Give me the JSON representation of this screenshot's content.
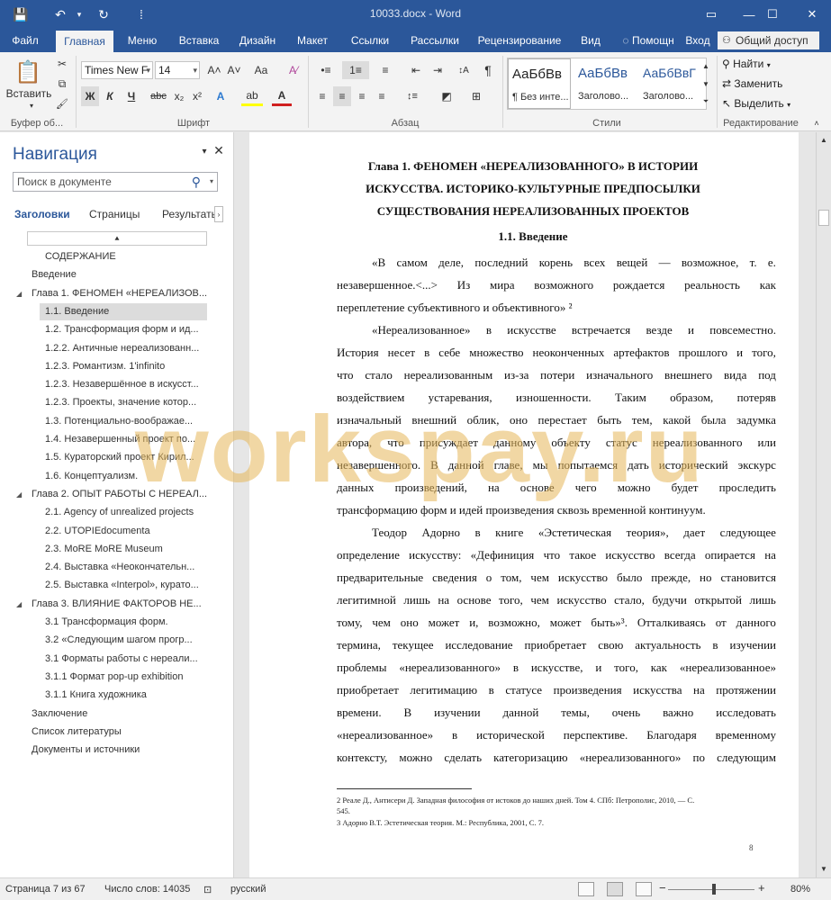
{
  "titlebar": {
    "title": "10033.docx - Word",
    "save_icon": "💾",
    "undo_icon": "↶",
    "redo_icon": "↻",
    "customize_icon": "⁞"
  },
  "window": {
    "restore": "▭",
    "minimize": "—",
    "maximize": "☐",
    "close": "✕"
  },
  "menu": {
    "tabs": [
      "Файл",
      "Главная",
      "Меню",
      "Вставка",
      "Дизайн",
      "Макет",
      "Ссылки",
      "Рассылки",
      "Рецензирование",
      "Вид"
    ],
    "help": "Помощн",
    "login": "Вход",
    "share": "Общий доступ"
  },
  "ribbon": {
    "clipboard": {
      "paste": "Вставить",
      "label": "Буфер об...",
      "cut": "✂",
      "copy": "⧉",
      "brush": "🖌"
    },
    "font": {
      "family": "Times New F",
      "size": "14",
      "label": "Шрифт",
      "grow": "A˄",
      "shrink": "A˅",
      "case": "Aa",
      "clear": "A⁄",
      "bold": "Ж",
      "italic": "К",
      "underline": "Ч",
      "strike": "abc",
      "sub": "x₂",
      "sup": "x²",
      "effects": "A",
      "highlight": "ab",
      "color": "A"
    },
    "paragraph": {
      "label": "Абзац",
      "pilcrow": "¶",
      "sort": "↕A",
      "bullets": "•≡",
      "numbering": "1≡",
      "multilevel": "≡",
      "dec_indent": "⇤",
      "inc_indent": "⇥",
      "align_left": "≡",
      "center": "≡",
      "align_right": "≡",
      "justify": "≡",
      "spacing": "↕≡",
      "shading": "◩",
      "borders": "⊞"
    },
    "styles": {
      "label": "Стили",
      "items": [
        {
          "preview": "АаБбВв",
          "name": "¶ Без инте..."
        },
        {
          "preview": "АаБбВв",
          "name": "Заголово..."
        },
        {
          "preview": "АаБбВвГ",
          "name": "Заголово..."
        }
      ]
    },
    "editing": {
      "label": "Редактирование",
      "find": "Найти",
      "replace": "Заменить",
      "select": "Выделить"
    }
  },
  "nav": {
    "title": "Навигация",
    "search_placeholder": "Поиск в документе",
    "search_icon": "⚲",
    "tabs": [
      "Заголовки",
      "Страницы",
      "Результаты"
    ],
    "collapse_icon": "⯅",
    "headings": [
      {
        "text": "СОДЕРЖАНИЕ",
        "level": 2,
        "tri": ""
      },
      {
        "text": "Введение",
        "level": 1,
        "tri": ""
      },
      {
        "text": "Глава 1. ФЕНОМЕН «НЕРЕАЛИЗОВ...",
        "level": 1,
        "tri": "◢"
      },
      {
        "text": "1.1. Введение",
        "level": 2,
        "tri": "",
        "sel": true
      },
      {
        "text": "1.2. Трансформация форм и ид...",
        "level": 2,
        "tri": ""
      },
      {
        "text": "1.2.2. Античные нереализованн...",
        "level": 2,
        "tri": ""
      },
      {
        "text": "1.2.3. Романтизм. 1'infinito",
        "level": 2,
        "tri": ""
      },
      {
        "text": "1.2.3. Незавершённое в искусст...",
        "level": 2,
        "tri": ""
      },
      {
        "text": "1.2.3. Проекты, значение котор...",
        "level": 2,
        "tri": ""
      },
      {
        "text": "1.3. Потенциально-воображае...",
        "level": 2,
        "tri": ""
      },
      {
        "text": "1.4. Незавершенный проект по...",
        "level": 2,
        "tri": ""
      },
      {
        "text": "1.5. Кураторский проект Кирил...",
        "level": 2,
        "tri": ""
      },
      {
        "text": "1.6. Концептуализм.",
        "level": 2,
        "tri": ""
      },
      {
        "text": "Глава 2. ОПЫТ РАБОТЫ С НЕРЕАЛ...",
        "level": 1,
        "tri": "◢"
      },
      {
        "text": "2.1. Agency of unrealized projects",
        "level": 2,
        "tri": ""
      },
      {
        "text": "2.2. UTOPIEdocumenta",
        "level": 2,
        "tri": ""
      },
      {
        "text": "2.3. MoRE MoRE Museum",
        "level": 2,
        "tri": ""
      },
      {
        "text": "2.4. Выставка «Неокончательн...",
        "level": 2,
        "tri": ""
      },
      {
        "text": "2.5. Выставка «Interpol», курато...",
        "level": 2,
        "tri": ""
      },
      {
        "text": "Глава 3. ВЛИЯНИЕ ФАКТОРОВ НЕ...",
        "level": 1,
        "tri": "◢"
      },
      {
        "text": "3.1 Трансформация форм.",
        "level": 2,
        "tri": ""
      },
      {
        "text": "3.2 «Следующим шагом прогр...",
        "level": 2,
        "tri": ""
      },
      {
        "text": "3.1 Форматы работы с нереали...",
        "level": 2,
        "tri": ""
      },
      {
        "text": "3.1.1 Формат pop-up exhibition",
        "level": 2,
        "tri": ""
      },
      {
        "text": "3.1.1 Книга художника",
        "level": 2,
        "tri": ""
      },
      {
        "text": "Заключение",
        "level": 1,
        "tri": ""
      },
      {
        "text": "Список литературы",
        "level": 1,
        "tri": ""
      },
      {
        "text": "Документы и источники",
        "level": 1,
        "tri": ""
      }
    ]
  },
  "doc": {
    "chapter_lines": [
      "Глава 1. ФЕНОМЕН «НЕРЕАЛИЗОВАННОГО» В ИСТОРИИ",
      "ИСКУССТВА. ИСТОРИКО-КУЛЬТУРНЫЕ ПРЕДПОСЫЛКИ",
      "СУЩЕСТВОВАНИЯ НЕРЕАЛИЗОВАННЫХ ПРОЕКТОВ"
    ],
    "section_title": "1.1. Введение",
    "lines": [
      {
        "text": "«В самом деле, последний корень всех вещей — возможное, т. е.",
        "indent": true,
        "just": true
      },
      {
        "text": "незавершенное.<...> Из мира возможного рождается реальность как",
        "indent": false,
        "just": true
      },
      {
        "text": "переплетение субъективного и объективного» ²",
        "indent": false,
        "just": false
      },
      {
        "text": "«Нереализованное» в искусстве встречается везде и повсеместно.",
        "indent": true,
        "just": true
      },
      {
        "text": "История несет в себе множество неоконченных артефактов прошлого и того,",
        "indent": false,
        "just": true
      },
      {
        "text": "что стало нереализованным из-за потери изначального внешнего вида под",
        "indent": false,
        "just": true
      },
      {
        "text": "воздействием устаревания, изношенности. Таким образом, потеряв",
        "indent": false,
        "just": true
      },
      {
        "text": "изначальный внешний облик, оно перестает быть тем, какой была задумка",
        "indent": false,
        "just": true
      },
      {
        "text": "автора, что присуждает данному объекту статус нереализованного или",
        "indent": false,
        "just": true
      },
      {
        "text": "незавершенного. В данной главе, мы попытаемся дать исторический экскурс",
        "indent": false,
        "just": true
      },
      {
        "text": "данных произведений, на основе чего можно будет проследить",
        "indent": false,
        "just": true
      },
      {
        "text": "трансформацию форм и идей произведения сквозь временной континуум.",
        "indent": false,
        "just": false
      },
      {
        "text": "Теодор Адорно в книге «Эстетическая теория», дает следующее",
        "indent": true,
        "just": true
      },
      {
        "text": "определение искусству: «Дефиниция что такое искусство всегда опирается на",
        "indent": false,
        "just": true
      },
      {
        "text": "предварительные сведения о том, чем искусство было прежде, но становится",
        "indent": false,
        "just": true
      },
      {
        "text": "легитимной лишь на основе того, чем искусство стало, будучи открытой лишь",
        "indent": false,
        "just": true
      },
      {
        "text": "тому, чем оно может и, возможно, может быть»³. Отталкиваясь от данного",
        "indent": false,
        "just": true
      },
      {
        "text": "термина, текущее исследование приобретает свою актуальность в изучении",
        "indent": false,
        "just": true
      },
      {
        "text": "проблемы «нереализованного» в искусстве, и того, как «нереализованное»",
        "indent": false,
        "just": true
      },
      {
        "text": "приобретает легитимацию в статусе произведения искусства на протяжении",
        "indent": false,
        "just": true
      },
      {
        "text": "времени. В изучении данной темы, очень важно исследовать",
        "indent": false,
        "just": true
      },
      {
        "text": "«нереализованное» в исторической перспективе. Благодаря временному",
        "indent": false,
        "just": true
      },
      {
        "text": "контексту, можно сделать категоризацию «нереализованного» по следующим",
        "indent": false,
        "just": true
      }
    ],
    "footnotes": [
      "2 Реале Д., Антисери Д. Западная философия от истоков до наших дней. Том 4. СПб: Петрополис, 2010, — С.",
      "545.",
      "3 Адорно В.Т. Эстетическая теория. М.: Республика, 2001, С. 7."
    ],
    "page_number": "8",
    "watermark": "workspay.ru"
  },
  "status": {
    "page": "Страница 7 из 67",
    "words": "Число слов: 14035",
    "proof_icon": "⊡",
    "lang": "русский",
    "zoom": "80%",
    "minus": "−",
    "plus": "+"
  }
}
